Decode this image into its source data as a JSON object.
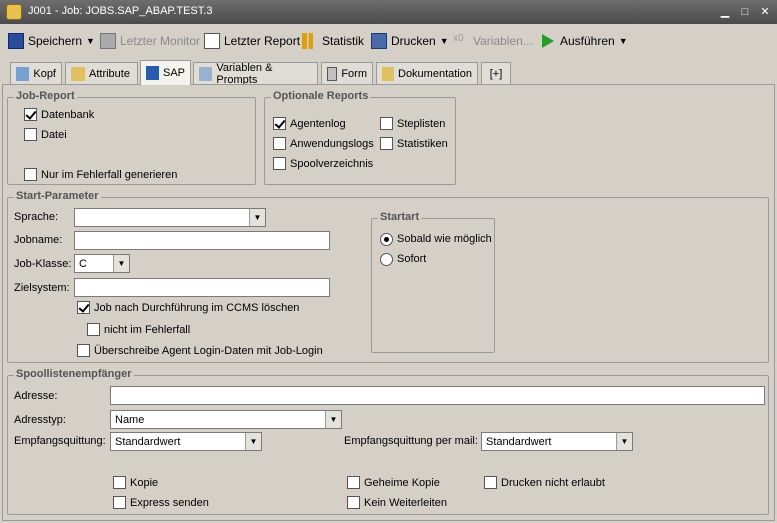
{
  "window": {
    "title": "J001 - Job: JOBS.SAP_ABAP.TEST.3"
  },
  "toolbar": {
    "save": "Speichern",
    "last_monitor": "Letzter Monitor",
    "last_report": "Letzter Report",
    "statistics": "Statistik",
    "print": "Drucken",
    "variables": "Variablen...",
    "execute": "Ausführen"
  },
  "tabs": [
    "Kopf",
    "Attribute",
    "SAP",
    "Variablen & Prompts",
    "Form",
    "Dokumentation",
    "[+]"
  ],
  "job_report": {
    "title": "Job-Report",
    "database": "Datenbank",
    "file": "Datei",
    "only_on_error": "Nur im Fehlerfall generieren",
    "database_checked": true,
    "file_checked": false,
    "only_on_error_checked": false
  },
  "optional_reports": {
    "title": "Optionale Reports",
    "agent_log": "Agentenlog",
    "application_logs": "Anwendungslogs",
    "spool_directory": "Spoolverzeichnis",
    "step_lists": "Steplisten",
    "statistics": "Statistiken",
    "agent_log_checked": true
  },
  "start_params": {
    "title": "Start-Parameter",
    "language_label": "Sprache:",
    "language_value": "",
    "jobname_label": "Jobname:",
    "jobname_value": "",
    "job_class_label": "Job-Klasse:",
    "job_class_value": "C",
    "target_system_label": "Zielsystem:",
    "target_system_value": "",
    "delete_ccms": "Job nach Durchführung im CCMS löschen",
    "delete_ccms_checked": true,
    "not_on_error": "nicht im Fehlerfall",
    "override_login": "Überschreibe Agent Login-Daten mit Job-Login"
  },
  "start_type": {
    "title": "Startart",
    "asap": "Sobald wie möglich",
    "immediately": "Sofort",
    "selected": "asap"
  },
  "spool": {
    "title": "Spoollistenempfänger",
    "address_label": "Adresse:",
    "address_value": "",
    "address_type_label": "Adresstyp:",
    "address_type_value": "Name",
    "receipt_label": "Empfangsquittung:",
    "receipt_value": "Standardwert",
    "receipt_mail_label": "Empfangsquittung per mail:",
    "receipt_mail_value": "Standardwert",
    "copy": "Kopie",
    "express": "Express senden",
    "secret_copy": "Geheime Kopie",
    "no_forward": "Kein Weiterleiten",
    "no_print": "Drucken nicht erlaubt"
  }
}
